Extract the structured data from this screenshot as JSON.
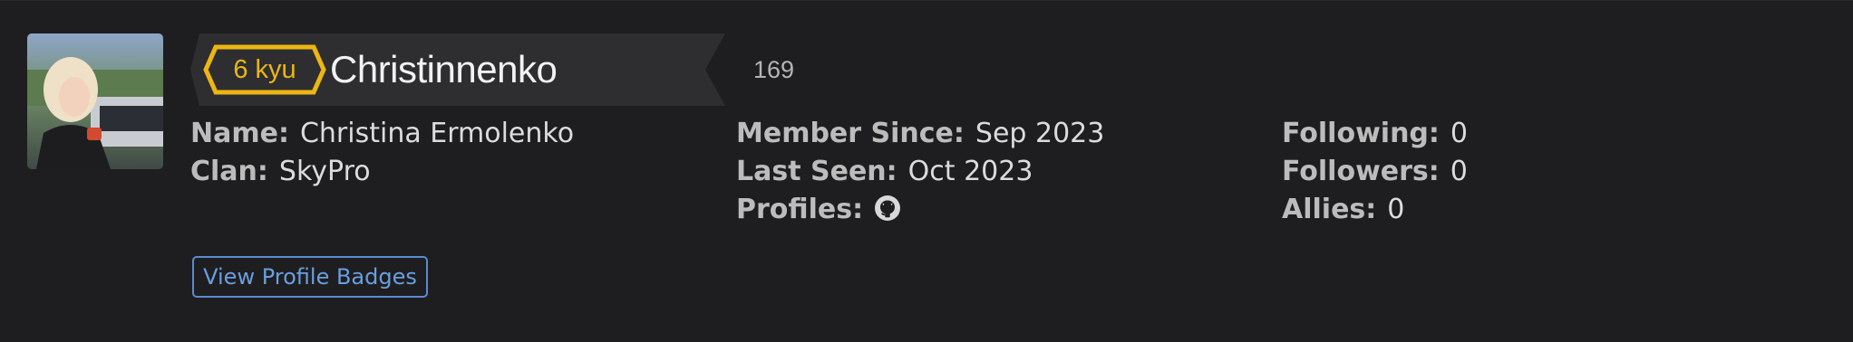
{
  "profile": {
    "rank": "6 kyu",
    "username": "Christinnenko",
    "honor": "169",
    "rank_color": "#ecb613",
    "avatar_icon": "user-photo"
  },
  "details": {
    "name_label": "Name:",
    "name_value": "Christina Ermolenko",
    "clan_label": "Clan:",
    "clan_value": "SkyPro",
    "member_since_label": "Member Since:",
    "member_since_value": "Sep 2023",
    "last_seen_label": "Last Seen:",
    "last_seen_value": "Oct 2023",
    "profiles_label": "Profiles:",
    "profiles_icon": "github-icon",
    "following_label": "Following:",
    "following_value": "0",
    "followers_label": "Followers:",
    "followers_value": "0",
    "allies_label": "Allies:",
    "allies_value": "0"
  },
  "actions": {
    "view_badges_label": "View Profile Badges",
    "accent_color": "#6a9ee0"
  }
}
